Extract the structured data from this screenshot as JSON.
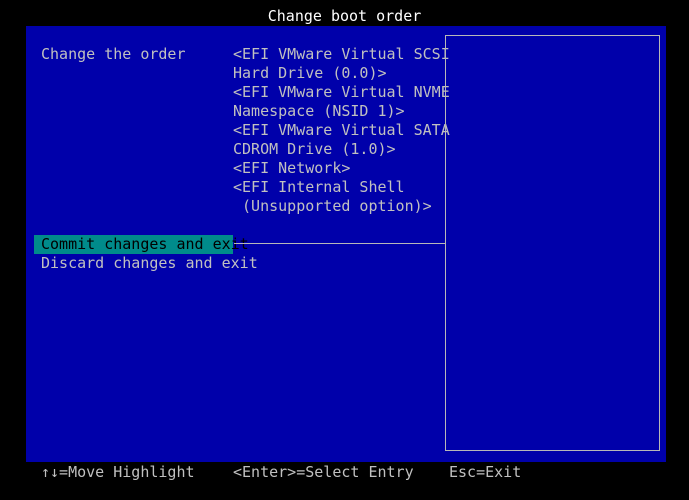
{
  "window": {
    "title": "Change boot order"
  },
  "main": {
    "label": "Change the order",
    "boot_order_lines": [
      "<EFI VMware Virtual SCSI",
      "Hard Drive (0.0)>",
      "<EFI VMware Virtual NVME",
      "Namespace (NSID 1)>",
      "<EFI VMware Virtual SATA",
      "CDROM Drive (1.0)>",
      "<EFI Network>",
      "<EFI Internal Shell",
      " (Unsupported option)>"
    ],
    "menu": [
      {
        "label": "Commit changes and exit",
        "selected": true
      },
      {
        "label": "Discard changes and exit",
        "selected": false
      }
    ]
  },
  "footer": {
    "move_hint": "↑↓=Move Highlight",
    "enter_hint": "<Enter>=Select Entry",
    "esc_hint": "Esc=Exit"
  },
  "colors": {
    "background": "#000000",
    "panel": "#0000aa",
    "text": "#c0c0c0",
    "title_text": "#ffffff",
    "highlight": "#008b8b"
  }
}
